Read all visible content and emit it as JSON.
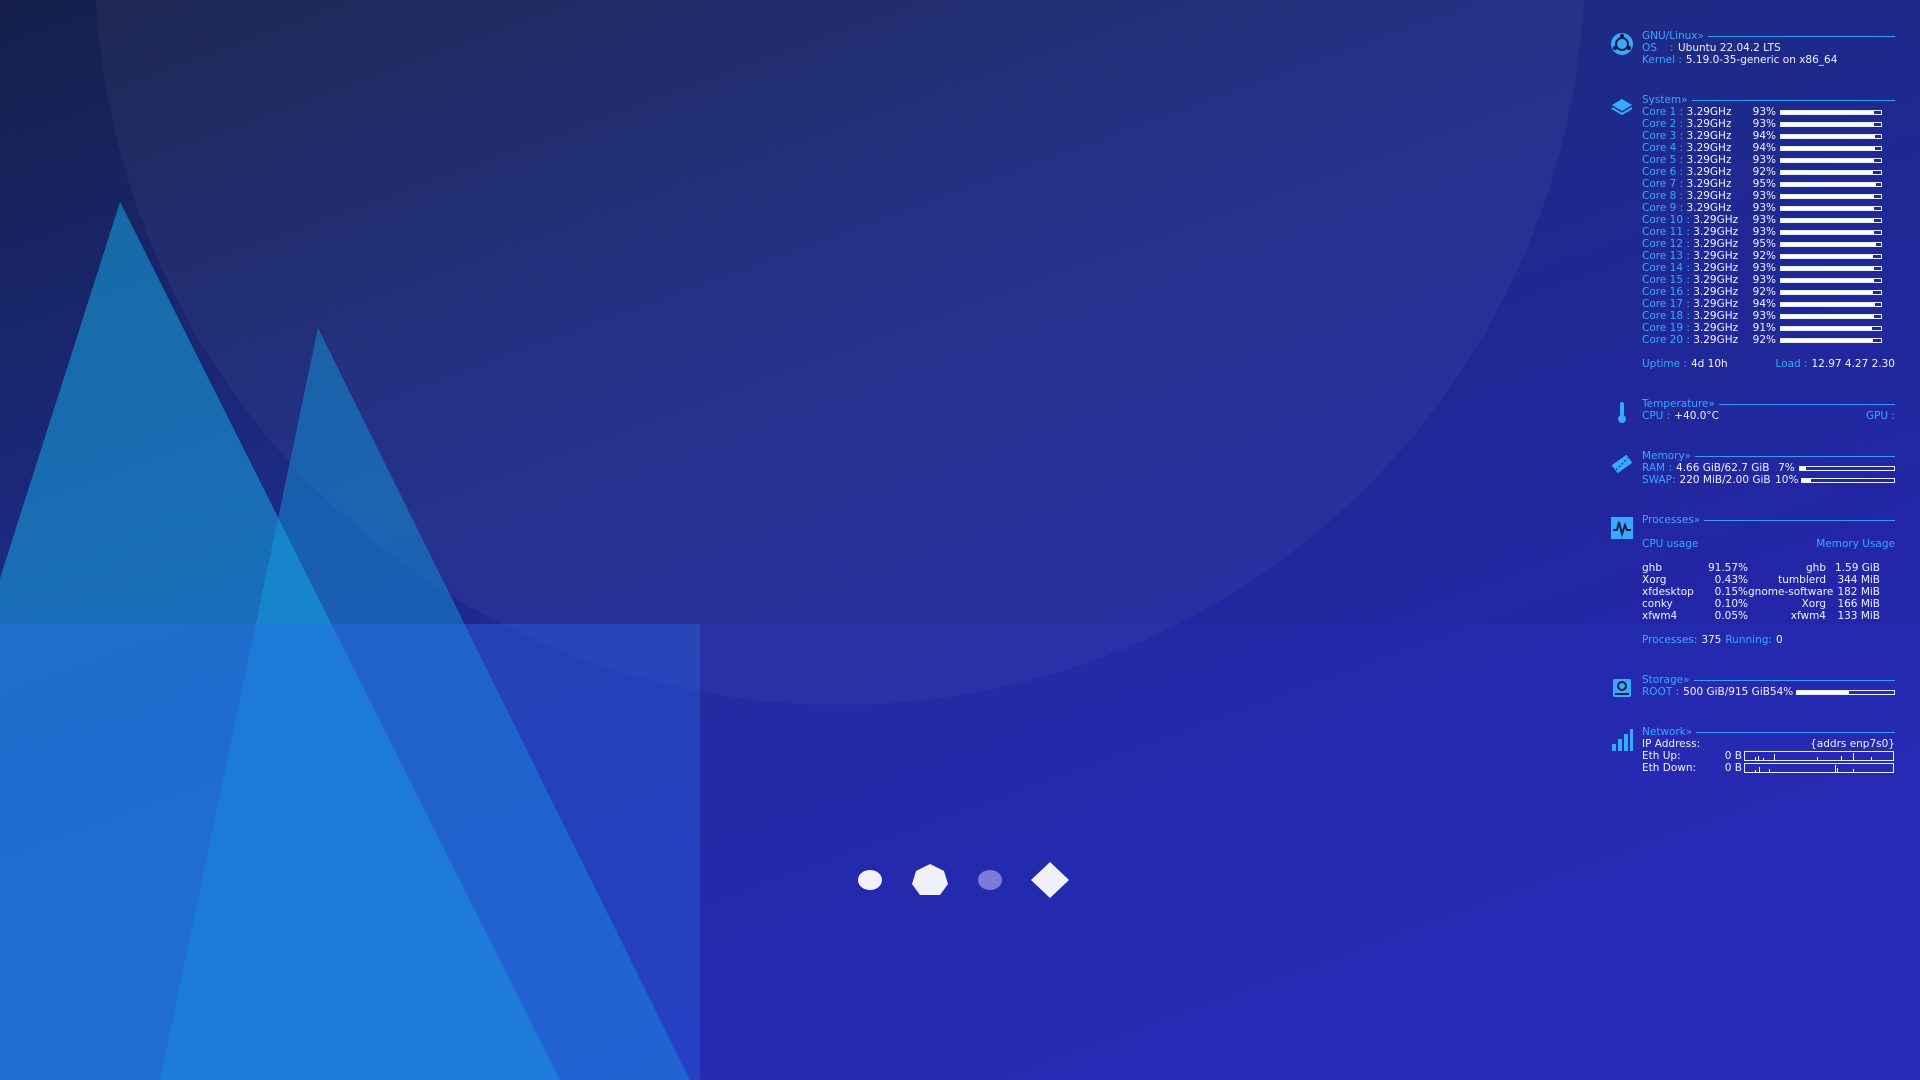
{
  "conky": {
    "os": {
      "header": "GNU/Linux»",
      "os_label": "OS",
      "os_sep": ":",
      "os_value": "Ubuntu 22.04.2 LTS",
      "kernel_label": "Kernel :",
      "kernel_value": "5.19.0-35-generic on x86_64"
    },
    "system": {
      "header": "System»",
      "cores": [
        {
          "label": "Core 1 :",
          "freq": "3.29GHz",
          "pct": "93%",
          "usage": 93
        },
        {
          "label": "Core 2 :",
          "freq": "3.29GHz",
          "pct": "93%",
          "usage": 93
        },
        {
          "label": "Core 3 :",
          "freq": "3.29GHz",
          "pct": "94%",
          "usage": 94
        },
        {
          "label": "Core 4 :",
          "freq": "3.29GHz",
          "pct": "94%",
          "usage": 94
        },
        {
          "label": "Core 5 :",
          "freq": "3.29GHz",
          "pct": "93%",
          "usage": 93
        },
        {
          "label": "Core 6 :",
          "freq": "3.29GHz",
          "pct": "92%",
          "usage": 92
        },
        {
          "label": "Core 7 :",
          "freq": "3.29GHz",
          "pct": "95%",
          "usage": 95
        },
        {
          "label": "Core 8 :",
          "freq": "3.29GHz",
          "pct": "93%",
          "usage": 93
        },
        {
          "label": "Core 9 :",
          "freq": "3.29GHz",
          "pct": "93%",
          "usage": 93
        },
        {
          "label": "Core 10 :",
          "freq": "3.29GHz",
          "pct": "93%",
          "usage": 93
        },
        {
          "label": "Core 11 :",
          "freq": "3.29GHz",
          "pct": "93%",
          "usage": 93
        },
        {
          "label": "Core 12 :",
          "freq": "3.29GHz",
          "pct": "95%",
          "usage": 95
        },
        {
          "label": "Core 13 :",
          "freq": "3.29GHz",
          "pct": "92%",
          "usage": 92
        },
        {
          "label": "Core 14 :",
          "freq": "3.29GHz",
          "pct": "93%",
          "usage": 93
        },
        {
          "label": "Core 15 :",
          "freq": "3.29GHz",
          "pct": "93%",
          "usage": 93
        },
        {
          "label": "Core 16 :",
          "freq": "3.29GHz",
          "pct": "92%",
          "usage": 92
        },
        {
          "label": "Core 17 :",
          "freq": "3.29GHz",
          "pct": "94%",
          "usage": 94
        },
        {
          "label": "Core 18 :",
          "freq": "3.29GHz",
          "pct": "93%",
          "usage": 93
        },
        {
          "label": "Core 19 :",
          "freq": "3.29GHz",
          "pct": "91%",
          "usage": 91
        },
        {
          "label": "Core 20 :",
          "freq": "3.29GHz",
          "pct": "92%",
          "usage": 92
        }
      ],
      "uptime_label": "Uptime :",
      "uptime_value": "4d 10h",
      "load_label": "Load :",
      "load_value": "12.97 4.27 2.30"
    },
    "temperature": {
      "header": "Temperature»",
      "cpu_label": "CPU :",
      "cpu_value": "+40.0°C",
      "gpu_label": "GPU :"
    },
    "memory": {
      "header": "Memory»",
      "ram_label": "RAM :",
      "ram_value": "4.66 GiB/62.7 GiB",
      "ram_pct": "7%",
      "ram_usage": 7,
      "swap_label": "SWAP:",
      "swap_value": "220 MiB/2.00 GiB",
      "swap_pct": "10%",
      "swap_usage": 10
    },
    "processes": {
      "header": "Processes»",
      "cpu_title": "CPU usage",
      "mem_title": "Memory Usage",
      "rows": [
        {
          "cpu_name": "ghb",
          "cpu_val": "91.57%",
          "mem_name": "ghb",
          "mem_val": "1.59 GiB"
        },
        {
          "cpu_name": "Xorg",
          "cpu_val": "0.43%",
          "mem_name": "tumblerd",
          "mem_val": "344 MiB"
        },
        {
          "cpu_name": "xfdesktop",
          "cpu_val": "0.15%",
          "mem_name": "gnome-software",
          "mem_val": "182 MiB"
        },
        {
          "cpu_name": "conky",
          "cpu_val": "0.10%",
          "mem_name": "Xorg",
          "mem_val": "166 MiB"
        },
        {
          "cpu_name": "xfwm4",
          "cpu_val": "0.05%",
          "mem_name": "xfwm4",
          "mem_val": "133 MiB"
        }
      ],
      "count_label": "Processes:",
      "count_value": "375",
      "running_label": "Running:",
      "running_value": "0"
    },
    "storage": {
      "header": "Storage»",
      "root_label": "ROOT :",
      "root_value": "500 GiB/915 GiB",
      "root_pct": "54%",
      "root_usage": 54
    },
    "network": {
      "header": "Network»",
      "ip_label": "IP Address:",
      "ip_value": "{addrs enp7s0}",
      "up_label": "Eth Up:",
      "up_value": "0 B",
      "down_label": "Eth Down:",
      "down_value": "0 B"
    }
  },
  "dock": {
    "items": [
      {
        "icon": "circle-icon"
      },
      {
        "icon": "heptagon-icon"
      },
      {
        "icon": "dim-circle-icon"
      },
      {
        "icon": "diamond-icon"
      }
    ]
  },
  "colors": {
    "accent": "#39a8ff",
    "text": "#eef2ff",
    "background": "#2326a8"
  }
}
